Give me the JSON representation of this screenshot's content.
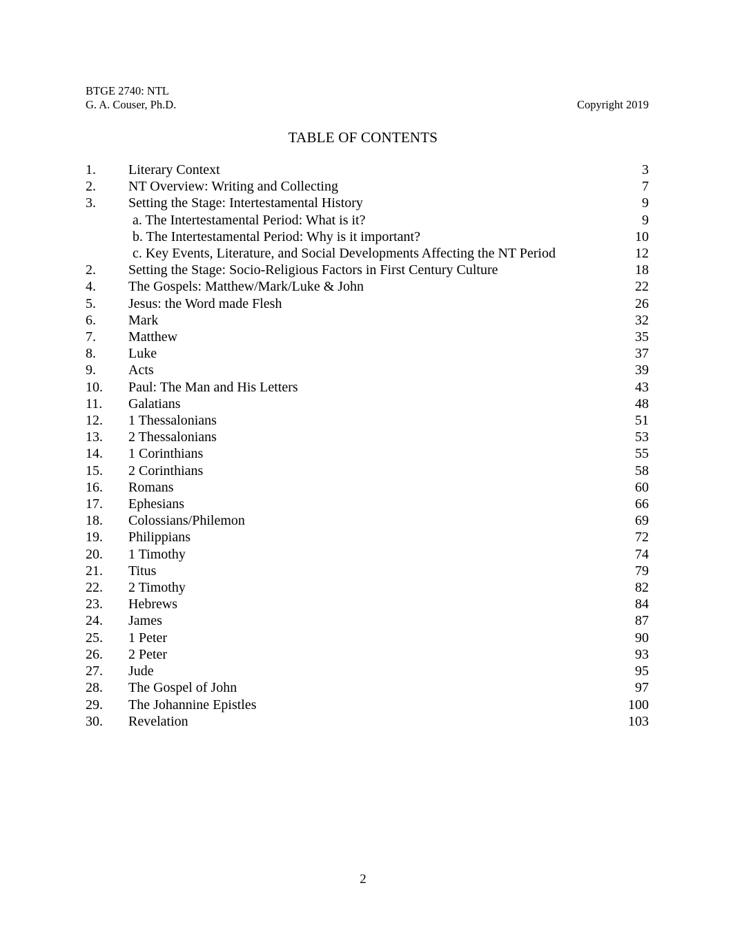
{
  "header": {
    "course": "BTGE 2740: NTL",
    "author": "G. A. Couser, Ph.D.",
    "copyright": "Copyright 2019"
  },
  "title": "TABLE OF CONTENTS",
  "footer": {
    "page_number": "2"
  },
  "toc": {
    "entries": [
      {
        "number": "1.",
        "title": "Literary Context",
        "page": "3",
        "sub": false
      },
      {
        "number": "2.",
        "title": "NT Overview: Writing and Collecting",
        "page": "7",
        "sub": false
      },
      {
        "number": "3.",
        "title": "Setting the Stage: Intertestamental History",
        "page": "9",
        "sub": false
      },
      {
        "number": "",
        "title": "a. The Intertestamental Period: What is it?",
        "page": "9",
        "sub": true
      },
      {
        "number": "",
        "title": "b. The Intertestamental Period: Why is it important?",
        "page": "10",
        "sub": true
      },
      {
        "number": "",
        "title": "c. Key Events, Literature, and Social Developments Affecting the NT Period",
        "page": "12",
        "sub": true
      },
      {
        "number": "2.",
        "title": "Setting the Stage: Socio-Religious Factors in First Century Culture",
        "page": "18",
        "sub": false
      },
      {
        "number": "4.",
        "title": "The Gospels: Matthew/Mark/Luke & John",
        "page": "22",
        "sub": false
      },
      {
        "number": "5.",
        "title": "Jesus: the Word made Flesh",
        "page": "26",
        "sub": false
      },
      {
        "number": "6.",
        "title": "Mark",
        "page": "32",
        "sub": false
      },
      {
        "number": "7.",
        "title": "Matthew",
        "page": "35",
        "sub": false
      },
      {
        "number": "8.",
        "title": "Luke",
        "page": "37",
        "sub": false
      },
      {
        "number": "9.",
        "title": "Acts",
        "page": "39",
        "sub": false
      },
      {
        "number": "10.",
        "title": "Paul: The Man and His Letters",
        "page": "43",
        "sub": false
      },
      {
        "number": "11.",
        "title": "Galatians",
        "page": "48",
        "sub": false
      },
      {
        "number": "12.",
        "title": "1 Thessalonians",
        "page": "51",
        "sub": false
      },
      {
        "number": "13.",
        "title": "2 Thessalonians",
        "page": "53",
        "sub": false
      },
      {
        "number": "14.",
        "title": "1 Corinthians",
        "page": "55",
        "sub": false
      },
      {
        "number": "15.",
        "title": "2 Corinthians",
        "page": "58",
        "sub": false
      },
      {
        "number": "16.",
        "title": "Romans",
        "page": "60",
        "sub": false
      },
      {
        "number": "17.",
        "title": "Ephesians",
        "page": "66",
        "sub": false
      },
      {
        "number": "18.",
        "title": "Colossians/Philemon",
        "page": "69",
        "sub": false
      },
      {
        "number": "19.",
        "title": "Philippians",
        "page": "72",
        "sub": false
      },
      {
        "number": "20.",
        "title": "1 Timothy",
        "page": "74",
        "sub": false
      },
      {
        "number": "21.",
        "title": "Titus",
        "page": "79",
        "sub": false
      },
      {
        "number": "22.",
        "title": "2 Timothy",
        "page": "82",
        "sub": false
      },
      {
        "number": "23.",
        "title": "Hebrews",
        "page": "84",
        "sub": false
      },
      {
        "number": "24.",
        "title": "James",
        "page": "87",
        "sub": false
      },
      {
        "number": "25.",
        "title": "1 Peter",
        "page": "90",
        "sub": false
      },
      {
        "number": "26.",
        "title": "2 Peter",
        "page": "93",
        "sub": false
      },
      {
        "number": "27.",
        "title": "Jude",
        "page": "95",
        "sub": false
      },
      {
        "number": "28.",
        "title": "The Gospel of John",
        "page": "97",
        "sub": false
      },
      {
        "number": "29.",
        "title": "The Johannine Epistles",
        "page": "100",
        "sub": false
      },
      {
        "number": "30.",
        "title": "Revelation",
        "page": "103",
        "sub": false
      }
    ]
  }
}
